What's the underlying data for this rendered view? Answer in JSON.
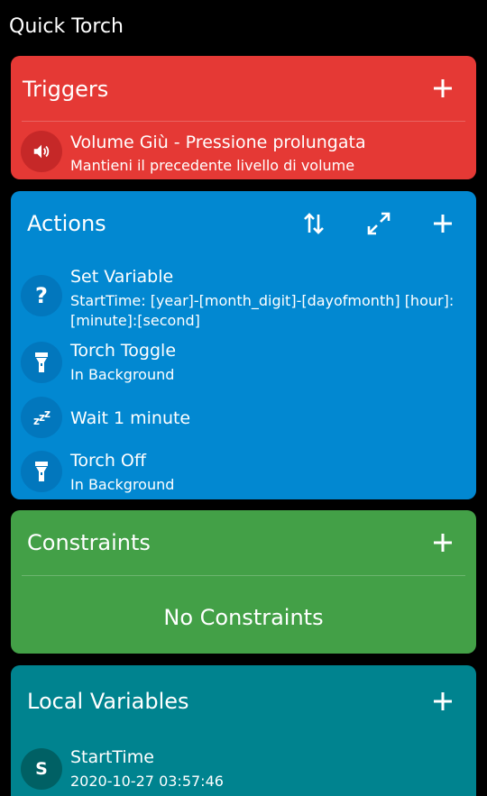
{
  "app": {
    "title": "Quick Torch"
  },
  "triggers": {
    "title": "Triggers",
    "items": [
      {
        "title": "Volume Giù - Pressione prolungata",
        "subtitle": "Mantieni il precedente livello di volume",
        "icon": "volume-icon"
      }
    ]
  },
  "actions": {
    "title": "Actions",
    "items": [
      {
        "title": "Set Variable",
        "subtitle": "StartTime: [year]-[month_digit]-[dayofmonth] [hour]:[minute]:[second]",
        "icon": "question-icon"
      },
      {
        "title": "Torch Toggle",
        "subtitle": "In Background",
        "icon": "flashlight-icon"
      },
      {
        "title": "Wait 1 minute",
        "subtitle": "",
        "icon": "sleep-icon"
      },
      {
        "title": "Torch Off",
        "subtitle": "In Background",
        "icon": "flashlight-icon"
      }
    ]
  },
  "constraints": {
    "title": "Constraints",
    "empty_text": "No Constraints"
  },
  "local_variables": {
    "title": "Local Variables",
    "items": [
      {
        "badge": "S",
        "title": "StartTime",
        "subtitle": "2020-10-27 03:57:46"
      }
    ]
  },
  "colors": {
    "triggers": "#e53935",
    "actions": "#0288d1",
    "constraints": "#43a047",
    "local_variables": "#00838f"
  }
}
